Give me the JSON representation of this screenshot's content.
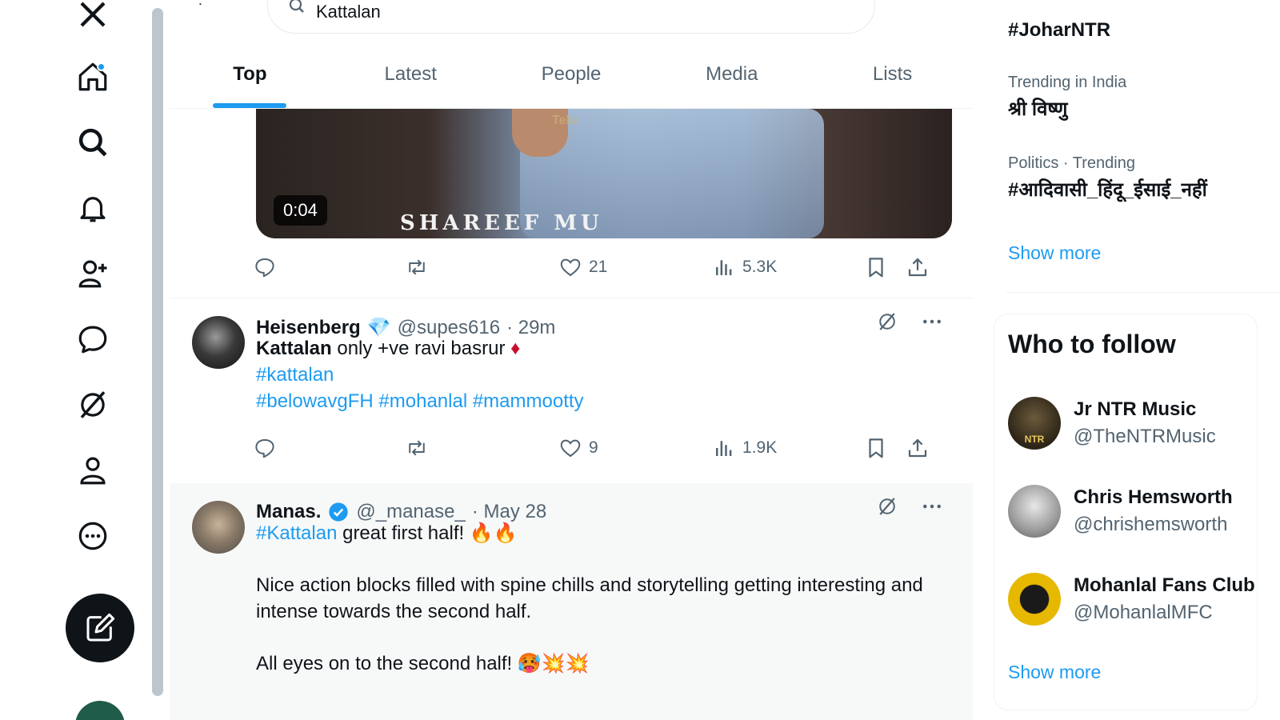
{
  "search": {
    "query": "Kattalan"
  },
  "tabs": [
    {
      "label": "Top",
      "active": true
    },
    {
      "label": "Latest",
      "active": false
    },
    {
      "label": "People",
      "active": false
    },
    {
      "label": "Media",
      "active": false
    },
    {
      "label": "Lists",
      "active": false
    }
  ],
  "video": {
    "time": "0:04",
    "caption": "SHAREEF MU",
    "brand_text": "Telu"
  },
  "tweet1_actions": {
    "likes": "21",
    "views": "5.3K"
  },
  "tweet2": {
    "name": "Heisenberg",
    "badge": "💎",
    "handle": "@supes616",
    "time": "· 29m",
    "line1_bold": "Kattalan",
    "line1_rest": " only +ve ravi basrur ",
    "line1_emoji": "♦",
    "hashtag1": "#kattalan",
    "hashtags2": "#belowavgFH #mohanlal #mammootty",
    "likes": "9",
    "views": "1.9K"
  },
  "tweet3": {
    "name": "Manas.",
    "handle": "@_manase_",
    "time": "· May 28",
    "hashtag": "#Kattalan",
    "line1_rest": " great first half! 🔥🔥",
    "para2": "Nice action blocks filled with spine chills and storytelling getting interesting and intense towards the second half.",
    "para3": "All eyes on to the second half! 🥵💥💥"
  },
  "trends": {
    "top": "#JoharNTR",
    "items": [
      {
        "context": "Trending in India",
        "name": "श्री विष्णु"
      },
      {
        "context": "Politics · Trending",
        "name": "#आदिवासी_हिंदू_ईसाई_नहीं"
      }
    ],
    "show_more": "Show more"
  },
  "who_to_follow": {
    "title": "Who to follow",
    "accounts": [
      {
        "name": "Jr NTR Music",
        "handle": "@TheNTRMusic",
        "avatar_text": "NTR"
      },
      {
        "name": "Chris Hemsworth",
        "handle": "@chrishemsworth"
      },
      {
        "name": "Mohanlal Fans Club",
        "handle": "@MohanlalMFC"
      }
    ],
    "show_more": "Show more"
  },
  "colors": {
    "accent": "#1d9bf0",
    "text": "#0f1419",
    "muted": "#536471"
  },
  "icons": [
    "x-logo-icon",
    "home-icon",
    "search-icon",
    "bell-icon",
    "follow-icon",
    "messages-icon",
    "grok-icon",
    "profile-icon",
    "more-icon",
    "compose-icon",
    "reply-icon",
    "retweet-icon",
    "like-icon",
    "views-icon",
    "bookmark-icon",
    "share-icon"
  ]
}
